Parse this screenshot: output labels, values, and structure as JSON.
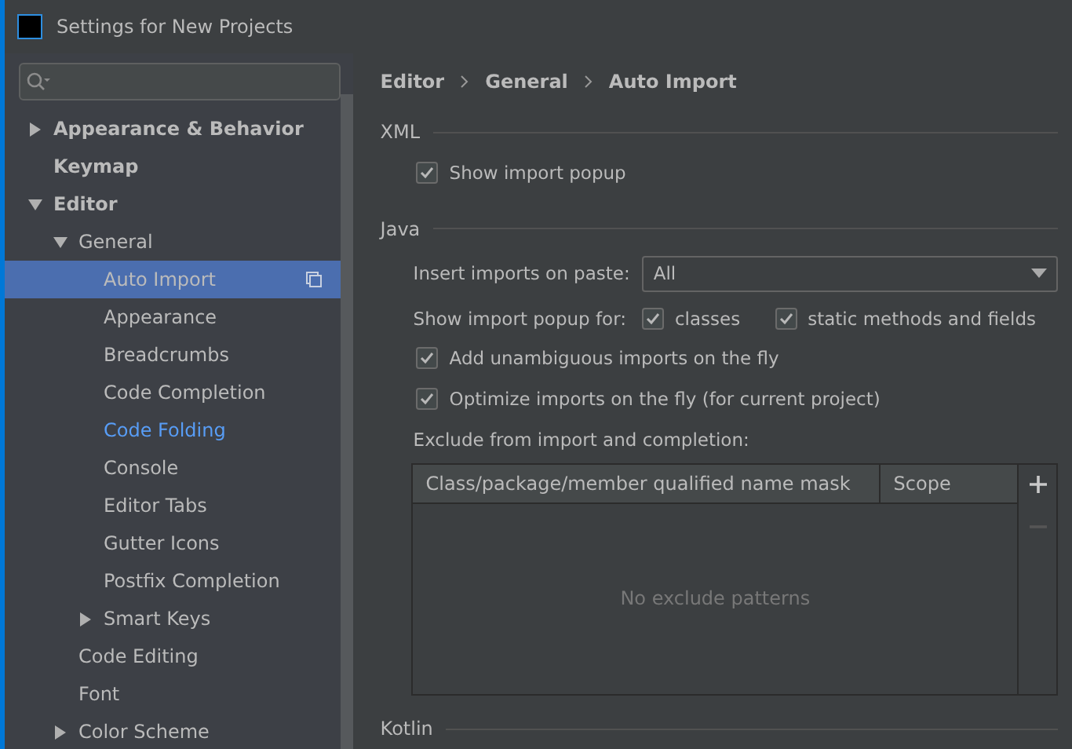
{
  "window": {
    "title": "Settings for New Projects"
  },
  "tree": [
    {
      "label": "Appearance & Behavior",
      "bold": true,
      "expanded": false,
      "selected": false
    },
    {
      "label": "Keymap",
      "bold": true,
      "selected": false
    },
    {
      "label": "Editor",
      "bold": true,
      "expanded": true,
      "selected": false,
      "children": [
        {
          "label": "General",
          "expanded": true,
          "selected": false,
          "children": [
            {
              "label": "Auto Import",
              "selected": true
            },
            {
              "label": "Appearance",
              "selected": false
            },
            {
              "label": "Breadcrumbs",
              "selected": false
            },
            {
              "label": "Code Completion",
              "selected": false
            },
            {
              "label": "Code Folding",
              "selected": false,
              "modified": true
            },
            {
              "label": "Console",
              "selected": false
            },
            {
              "label": "Editor Tabs",
              "selected": false
            },
            {
              "label": "Gutter Icons",
              "selected": false
            },
            {
              "label": "Postfix Completion",
              "selected": false
            },
            {
              "label": "Smart Keys",
              "expanded": false,
              "selected": false
            }
          ]
        },
        {
          "label": "Code Editing",
          "selected": false
        },
        {
          "label": "Font",
          "selected": false
        },
        {
          "label": "Color Scheme",
          "expanded": false,
          "selected": false
        }
      ]
    }
  ],
  "breadcrumbs": [
    "Editor",
    "General",
    "Auto Import"
  ],
  "xml": {
    "title": "XML",
    "show_import_popup": {
      "label": "Show import popup",
      "checked": true
    }
  },
  "java": {
    "title": "Java",
    "insert_imports": {
      "label": "Insert imports on paste:",
      "value": "All"
    },
    "popup_for": {
      "label": "Show import popup for:",
      "options": [
        {
          "label": "classes",
          "checked": true
        },
        {
          "label": "static methods and fields",
          "checked": true
        }
      ]
    },
    "options": [
      {
        "label": "Add unambiguous imports on the fly",
        "checked": true
      },
      {
        "label": "Optimize imports on the fly (for current project)",
        "checked": true
      }
    ],
    "exclude": {
      "label": "Exclude from import and completion:",
      "columns": [
        "Class/package/member qualified name mask",
        "Scope"
      ],
      "empty_text": "No exclude patterns",
      "add_disabled": false,
      "remove_disabled": true
    }
  },
  "next_section": {
    "title": "Kotlin"
  }
}
